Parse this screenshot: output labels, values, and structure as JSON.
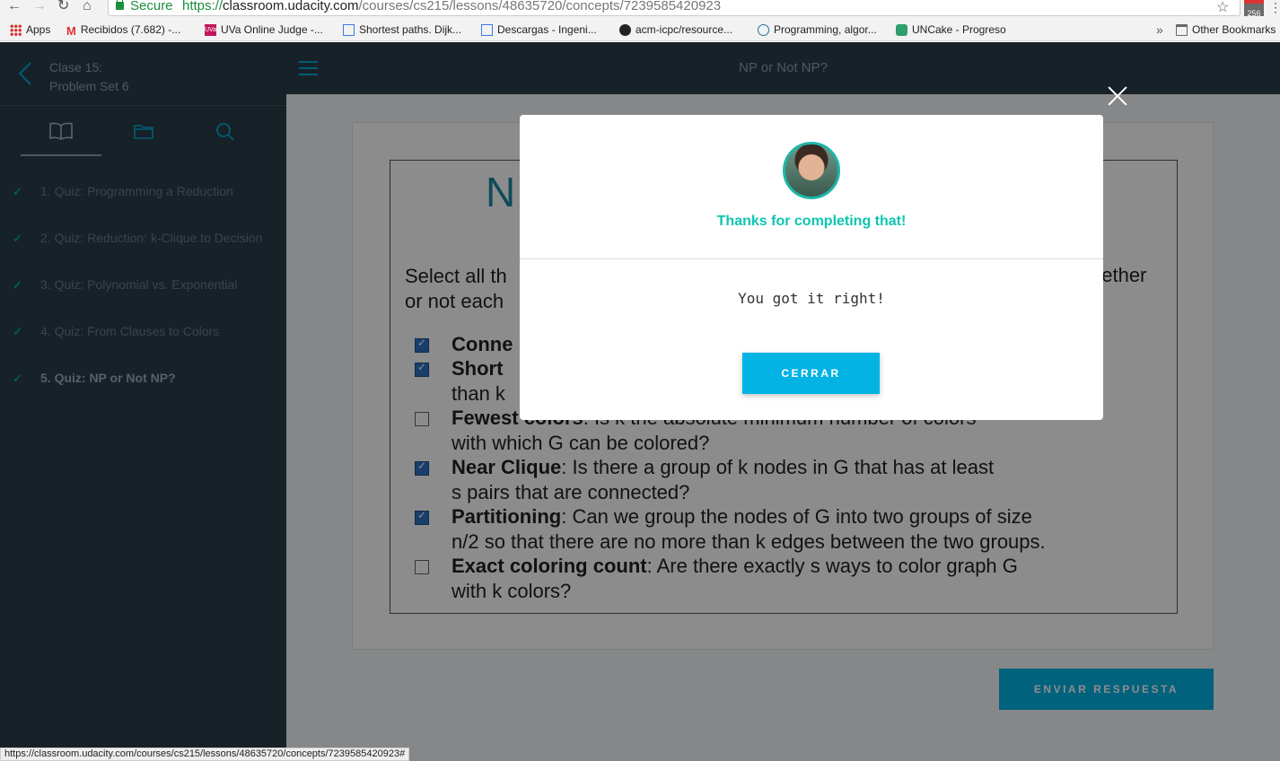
{
  "browser": {
    "secure_label": "Secure",
    "url_scheme": "https://",
    "url_host": "classroom.udacity.com",
    "url_path": "/courses/cs215/lessons/48635720/concepts/7239585420923",
    "extension_badge": "256",
    "bookmarks": [
      {
        "label": "Apps",
        "icon": "apps-icon"
      },
      {
        "label": "Recibidos (7.682) -...",
        "icon": "gmail-icon"
      },
      {
        "label": "UVa Online Judge -...",
        "icon": "uva-icon"
      },
      {
        "label": "Shortest paths. Dijk...",
        "icon": "document-icon"
      },
      {
        "label": "Descargas - Ingeni...",
        "icon": "document-icon"
      },
      {
        "label": "acm-icpc/resource...",
        "icon": "github-icon"
      },
      {
        "label": "Programming, algor...",
        "icon": "wordpress-icon"
      },
      {
        "label": "UNCake - Progreso",
        "icon": "cake-icon"
      }
    ],
    "more_label": "»",
    "other_bookmarks": "Other Bookmarks",
    "status_url": "https://classroom.udacity.com/courses/cs215/lessons/48635720/concepts/7239585420923#"
  },
  "sidebar": {
    "title_line1": "Clase 15:",
    "title_line2": "Problem Set 6",
    "lessons": [
      {
        "label": "1. Quiz: Programming a Reduction"
      },
      {
        "label": "2. Quiz: Reduction: k-Clique to Decision"
      },
      {
        "label": "3. Quiz: Polynomial vs. Exponential"
      },
      {
        "label": "4. Quiz: From Clauses to Colors"
      },
      {
        "label": "5. Quiz: NP or Not NP?"
      }
    ]
  },
  "topbar": {
    "title": "NP or Not NP?"
  },
  "quiz": {
    "heading_fragment": "N",
    "intro_line1": "Select all th",
    "intro_line2": "or not each",
    "intro_right": "hether",
    "options": [
      {
        "checked": true,
        "bold": "Conne",
        "rest": ""
      },
      {
        "checked": true,
        "bold": "Short",
        "rest": ""
      },
      {
        "checked": false,
        "bold": "Fewest colors",
        "rest": ": Is k the absolute minimum number of colors"
      }
    ],
    "line_than_k": "than k",
    "line_fewest_2": "with which G can be colored?",
    "near_clique_bold": "Near Clique",
    "near_clique_rest": ": Is there a group of k nodes in G that has at least",
    "near_clique_2": "s pairs that are connected?",
    "partition_bold": "Partitioning",
    "partition_rest": ": Can we group the nodes of G into two groups of size",
    "partition_2": "n/2 so that there are no more than k edges between the two groups.",
    "exact_bold": "Exact coloring count",
    "exact_rest": ": Are there exactly s ways to color graph G",
    "exact_2": "with k colors?",
    "submit_label": "ENVIAR RESPUESTA"
  },
  "modal": {
    "heading": "Thanks for completing that!",
    "message": "You got it right!",
    "button_label": "CERRAR"
  },
  "colors": {
    "accent": "#02b3e4",
    "success": "#0ec5b0",
    "sidebar_bg": "#2b3c4a"
  }
}
